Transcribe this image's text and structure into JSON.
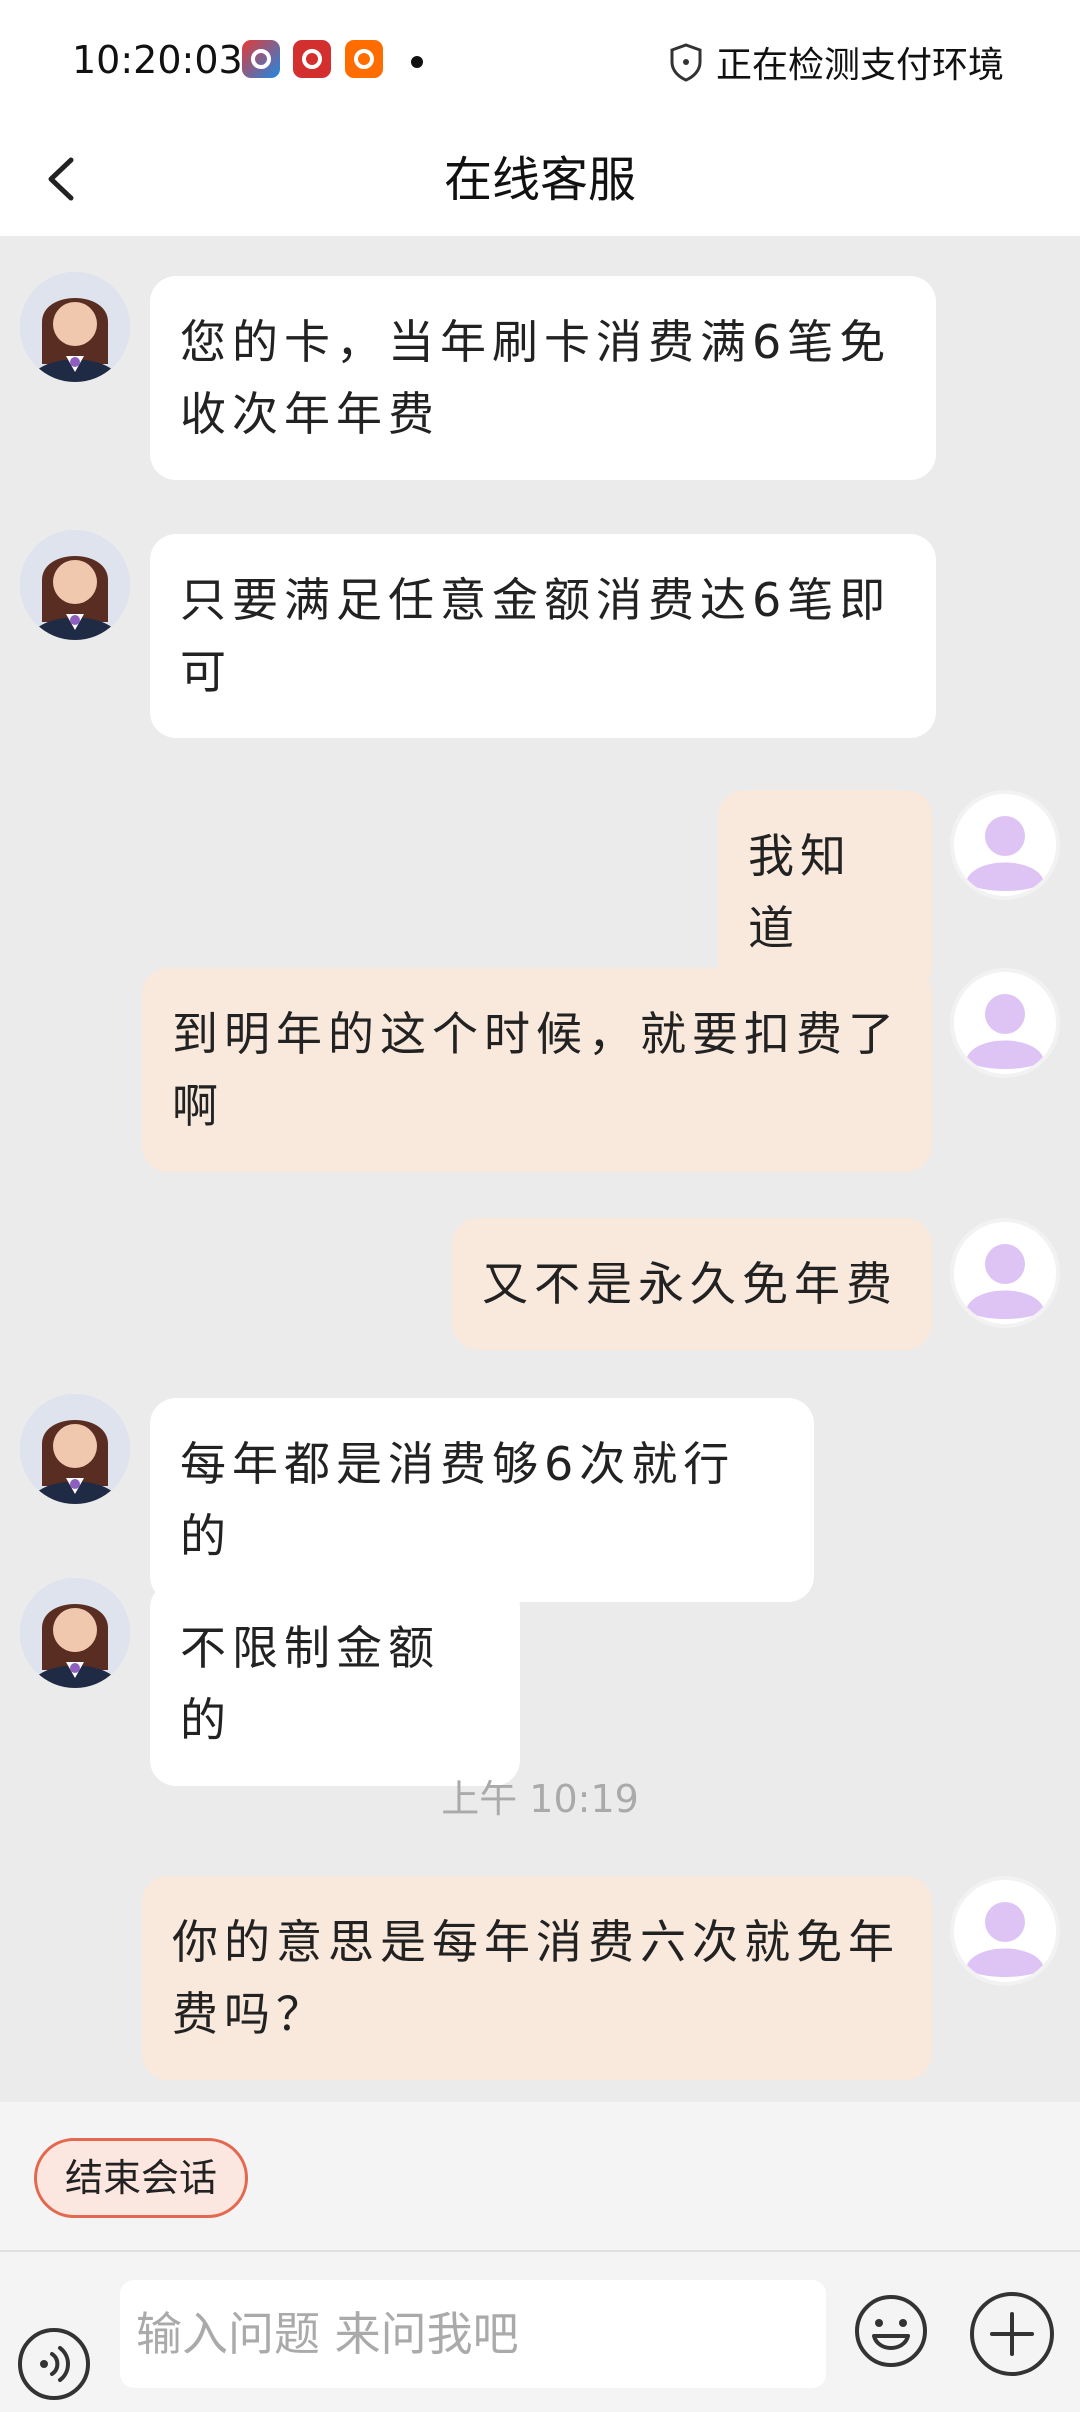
{
  "status_bar": {
    "time": "10:20:03",
    "right_text": "正在检测支付环境"
  },
  "nav": {
    "title": "在线客服"
  },
  "messages": [
    {
      "sender": "agent",
      "text": "您的卡，当年刷卡消费满6笔免收次年年费"
    },
    {
      "sender": "agent",
      "text": "只要满足任意金额消费达6笔即可"
    },
    {
      "sender": "user",
      "text": "我知道"
    },
    {
      "sender": "user",
      "text": "到明年的这个时候，就要扣费了啊"
    },
    {
      "sender": "user",
      "text": "又不是永久免年费"
    },
    {
      "sender": "agent",
      "text": "每年都是消费够6次就行的"
    },
    {
      "sender": "agent",
      "text": "不限制金额的"
    },
    {
      "sender": "user",
      "text": "你的意思是每年消费六次就免年费吗？"
    }
  ],
  "timestamp": "上午 10:19",
  "bottom": {
    "end_session_label": "结束会话",
    "input_placeholder": "输入问题 来问我吧"
  },
  "colors": {
    "agent_bubble": "#ffffff",
    "user_bubble": "#f8e9dc",
    "chat_background": "#ebebeb",
    "end_button_border": "#e2694f"
  }
}
